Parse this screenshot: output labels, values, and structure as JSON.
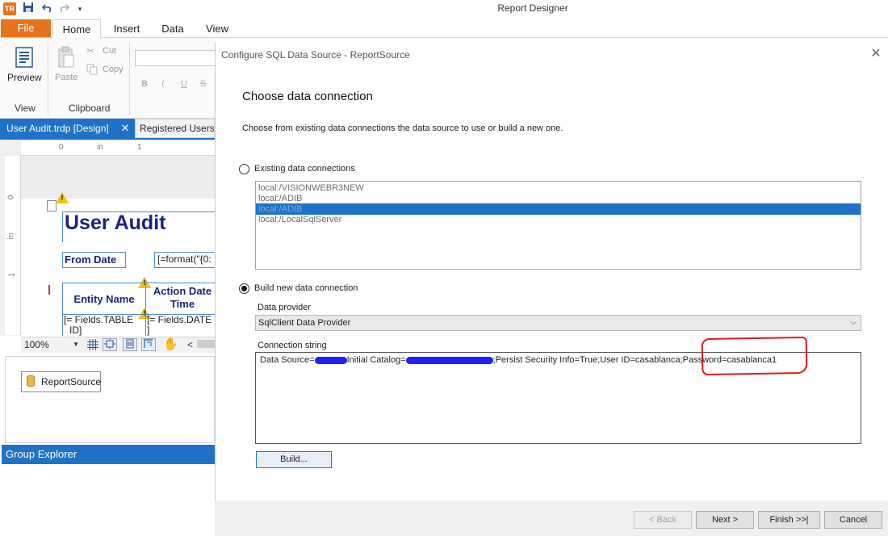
{
  "window": {
    "title": "Report Designer",
    "app_icon": "TR"
  },
  "quick_access": {
    "save_icon": "save-icon",
    "undo_icon": "undo-icon",
    "redo_icon": "redo-icon",
    "customize_icon": "customize-icon"
  },
  "ribbon": {
    "tabs": [
      "File",
      "Home",
      "Insert",
      "Data",
      "View"
    ],
    "preview_label": "Preview",
    "paste_label": "Paste",
    "cut_label": "Cut",
    "copy_label": "Copy",
    "group_view": "View",
    "group_clipboard": "Clipboard",
    "format_buttons": [
      "B",
      "I",
      "U",
      "S"
    ]
  },
  "doc_tabs": {
    "active": "User Audit.trdp [Design]",
    "close": "✕",
    "second": "Registered Users"
  },
  "designer": {
    "ruler_marks": [
      "0",
      "in",
      "1"
    ],
    "ruler_left_marks": [
      "0",
      "in",
      "1"
    ],
    "report_title": "User Audit",
    "from_date": "From Date",
    "format_expr": "[=format(\"{0:",
    "col_entity": "Entity Name",
    "col_action": "Action Date Time",
    "cell_entity_1": "[= Fields.TABLE",
    "cell_entity_2": "ID]",
    "cell_action_1": "[= Fields.DATE",
    "cell_action_2": "]",
    "warn_mark": "!"
  },
  "zoom": {
    "value": "100%",
    "arrow": "▼",
    "scroll_left": "<"
  },
  "data_sources": {
    "item": "ReportSource"
  },
  "group_explorer": {
    "title": "Group Explorer"
  },
  "dialog": {
    "title": "Configure SQL Data Source - ReportSource",
    "close": "✕",
    "heading": "Choose data connection",
    "description": "Choose from existing data connections the data source to use or build a new one.",
    "existing_label": "Existing data connections",
    "existing_connections": [
      "local:/VISIONWEBR3NEW",
      "local:/ADIB",
      "local:/ADIB",
      "local:/LocalSqlServer"
    ],
    "selected_index": 2,
    "build_new_label": "Build new data connection",
    "provider_label": "Data provider",
    "provider_value": "SqlClient Data Provider",
    "provider_chevron": "⌵",
    "connstr_label": "Connection string",
    "connstr_part1": "Data Source=",
    "connstr_part2": "Initial Catalog=",
    "connstr_part3": ";Persist Security Info=True;User ID=casablanca;",
    "connstr_part4": "Password=casablanca1",
    "build_button": "Build...",
    "footer": {
      "back": "< Back",
      "next": "Next >",
      "finish": "Finish >>|",
      "cancel": "Cancel"
    }
  },
  "colors": {
    "accent": "#1e73c8",
    "file_tab": "#e8731a",
    "highlight": "#e01818",
    "redaction": "#2020ff"
  }
}
